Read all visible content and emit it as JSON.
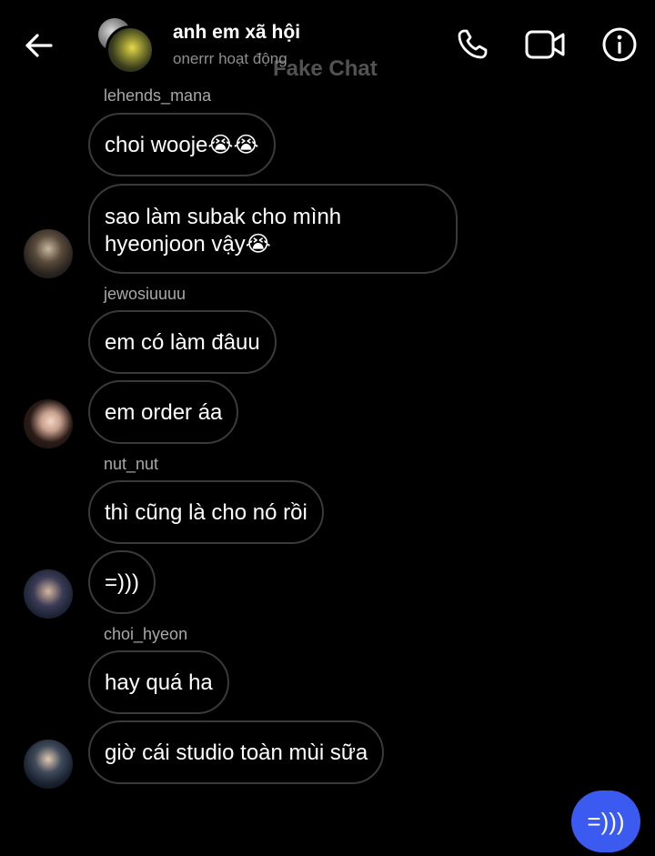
{
  "header": {
    "title": "anh em xã hội",
    "status": "onerrr hoạt động",
    "watermark": "Fake Chat",
    "icons": [
      "back-arrow-icon",
      "phone-icon",
      "video-camera-icon",
      "info-icon"
    ]
  },
  "messages": [
    {
      "sender": "lehends_mana",
      "texts": [
        "choi wooje😭😭",
        "sao làm subak cho mình hyeonjoon vậy😭"
      ]
    },
    {
      "sender": "jewosiuuuu",
      "texts": [
        "em có làm đâuu",
        "em order áa"
      ]
    },
    {
      "sender": "nut_nut",
      "texts": [
        "thì cũng là cho nó rồi",
        "=)))"
      ]
    },
    {
      "sender": "choi_hyeon",
      "texts": [
        "hay quá ha",
        "giờ cái studio toàn mùi sữa"
      ]
    }
  ],
  "outgoing": {
    "text": "=)))",
    "color": "#3b5bf0"
  }
}
